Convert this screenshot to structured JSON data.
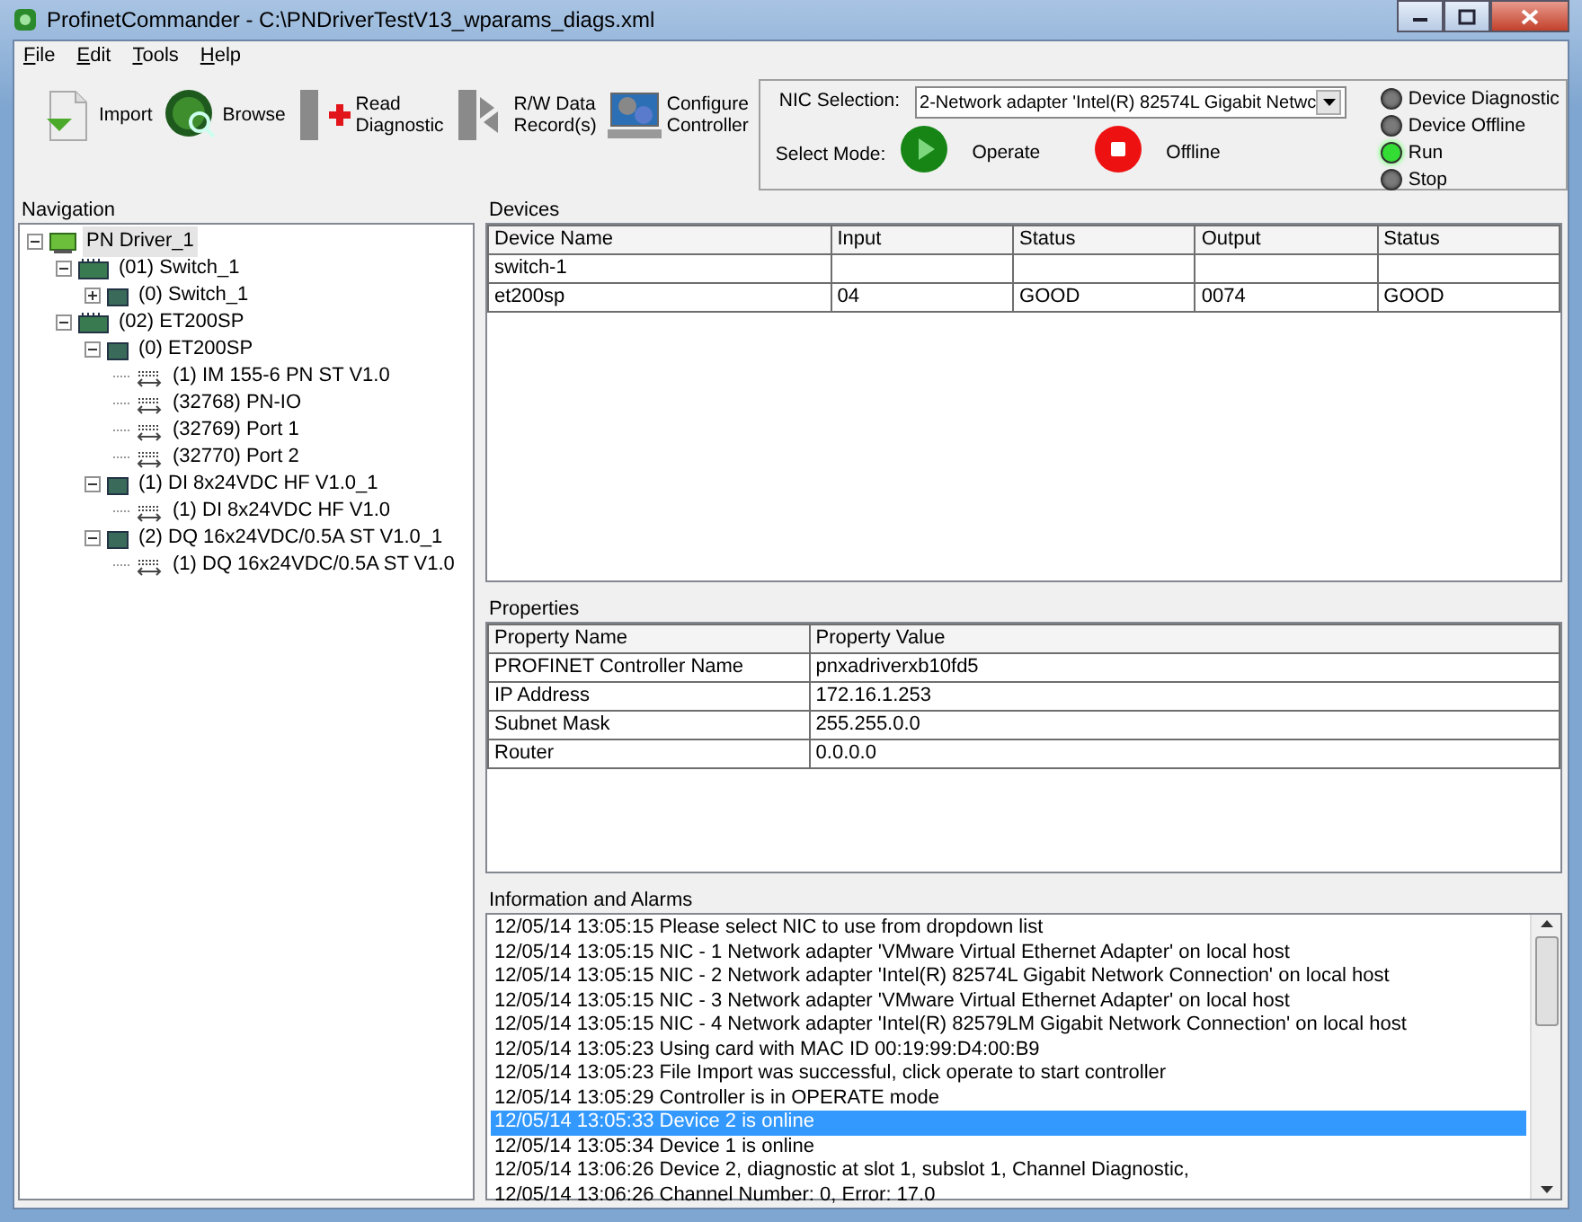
{
  "window": {
    "title": "ProfinetCommander - C:\\PNDriverTestV13_wparams_diags.xml"
  },
  "menu": [
    {
      "label": "File"
    },
    {
      "label": "Edit"
    },
    {
      "label": "Tools"
    },
    {
      "label": "Help"
    }
  ],
  "toolbar": [
    {
      "label": "Import",
      "kind": "import"
    },
    {
      "label": "Browse",
      "kind": "browse"
    },
    {
      "label": "Read Diagnostic",
      "kind": "diagnostic"
    },
    {
      "label": "R/W Data Record(s)",
      "kind": "record"
    },
    {
      "label": "Configure Controller",
      "kind": "configure"
    }
  ],
  "nic": {
    "label": "NIC Selection:",
    "value": "2-Network adapter 'Intel(R) 82574L Gigabit Netwc"
  },
  "mode": {
    "label": "Select Mode:",
    "buttons": [
      {
        "label": "Operate",
        "kind": "play"
      },
      {
        "label": "Offline",
        "kind": "stop"
      }
    ]
  },
  "indicators": [
    {
      "label": "Device Diagnostic",
      "on": false,
      "color": "#7a7a7a"
    },
    {
      "label": "Device Offline",
      "on": false,
      "color": "#7a7a7a"
    },
    {
      "label": "Run",
      "on": true,
      "color": "#33dd33"
    },
    {
      "label": "Stop",
      "on": false,
      "color": "#7a7a7a"
    }
  ],
  "navigation": {
    "title": "Navigation",
    "tree": [
      {
        "label": "PN Driver_1",
        "kind": "controller",
        "selected": true,
        "expanded": true,
        "children": [
          {
            "label": "(01) Switch_1",
            "kind": "station",
            "selected": false,
            "expanded": true,
            "children": [
              {
                "label": "(0) Switch_1",
                "kind": "module",
                "selected": false,
                "expanded": false
              }
            ]
          },
          {
            "label": "(02) ET200SP",
            "kind": "station",
            "selected": false,
            "expanded": true,
            "children": [
              {
                "label": "(0) ET200SP",
                "kind": "module",
                "selected": false,
                "expanded": true,
                "children": [
                  {
                    "label": "(1) IM 155-6 PN ST V1.0",
                    "kind": "submodule",
                    "selected": false
                  },
                  {
                    "label": "(32768) PN-IO",
                    "kind": "submodule",
                    "selected": false
                  },
                  {
                    "label": "(32769) Port 1",
                    "kind": "submodule",
                    "selected": false
                  },
                  {
                    "label": "(32770) Port 2",
                    "kind": "submodule",
                    "selected": false
                  }
                ]
              },
              {
                "label": "(1) DI 8x24VDC HF V1.0_1",
                "kind": "module",
                "selected": false,
                "expanded": true,
                "children": [
                  {
                    "label": "(1) DI 8x24VDC HF V1.0",
                    "kind": "submodule",
                    "selected": false
                  }
                ]
              },
              {
                "label": "(2) DQ 16x24VDC/0.5A ST V1.0_1",
                "kind": "module",
                "selected": false,
                "expanded": true,
                "children": [
                  {
                    "label": "(1) DQ 16x24VDC/0.5A ST V1.0",
                    "kind": "submodule",
                    "selected": false
                  }
                ]
              }
            ]
          }
        ]
      }
    ]
  },
  "devices": {
    "title": "Devices",
    "columns": [
      "Device Name",
      "Input",
      "Status",
      "Output",
      "Status"
    ],
    "rows": [
      [
        "switch-1",
        "",
        "",
        "",
        ""
      ],
      [
        "et200sp",
        "04",
        "GOOD",
        "0074",
        "GOOD"
      ]
    ]
  },
  "properties": {
    "title": "Properties",
    "columns": [
      "Property Name",
      "Property Value"
    ],
    "rows": [
      [
        "PROFINET Controller Name",
        "pnxadriverxb10fd5"
      ],
      [
        "IP Address",
        "172.16.1.253"
      ],
      [
        "Subnet Mask",
        "255.255.0.0"
      ],
      [
        "Router",
        "0.0.0.0"
      ]
    ]
  },
  "log": {
    "title": "Information and Alarms",
    "lines": [
      {
        "text": "12/05/14 13:05:15 Please select NIC to use from dropdown list",
        "selected": false
      },
      {
        "text": "12/05/14 13:05:15 NIC - 1 Network adapter 'VMware Virtual Ethernet Adapter' on local host",
        "selected": false
      },
      {
        "text": "12/05/14 13:05:15 NIC - 2 Network adapter 'Intel(R) 82574L Gigabit Network Connection' on local host",
        "selected": false
      },
      {
        "text": "12/05/14 13:05:15 NIC - 3 Network adapter 'VMware Virtual Ethernet Adapter' on local host",
        "selected": false
      },
      {
        "text": "12/05/14 13:05:15 NIC - 4 Network adapter 'Intel(R) 82579LM Gigabit Network Connection' on local host",
        "selected": false
      },
      {
        "text": "12/05/14 13:05:23 Using card with MAC ID 00:19:99:D4:00:B9",
        "selected": false
      },
      {
        "text": "12/05/14 13:05:23 File Import was successful, click operate to start controller",
        "selected": false
      },
      {
        "text": "12/05/14 13:05:29  Controller is in OPERATE mode",
        "selected": false
      },
      {
        "text": "12/05/14 13:05:33  Device 2 is online",
        "selected": true
      },
      {
        "text": "12/05/14 13:05:34  Device 1 is online",
        "selected": false
      },
      {
        "text": "12/05/14 13:06:26  Device 2, diagnostic at slot 1, subslot 1, Channel Diagnostic,",
        "selected": false
      },
      {
        "text": "12/05/14 13:06:26      Channel Number: 0, Error: 17.0",
        "selected": false
      }
    ]
  }
}
